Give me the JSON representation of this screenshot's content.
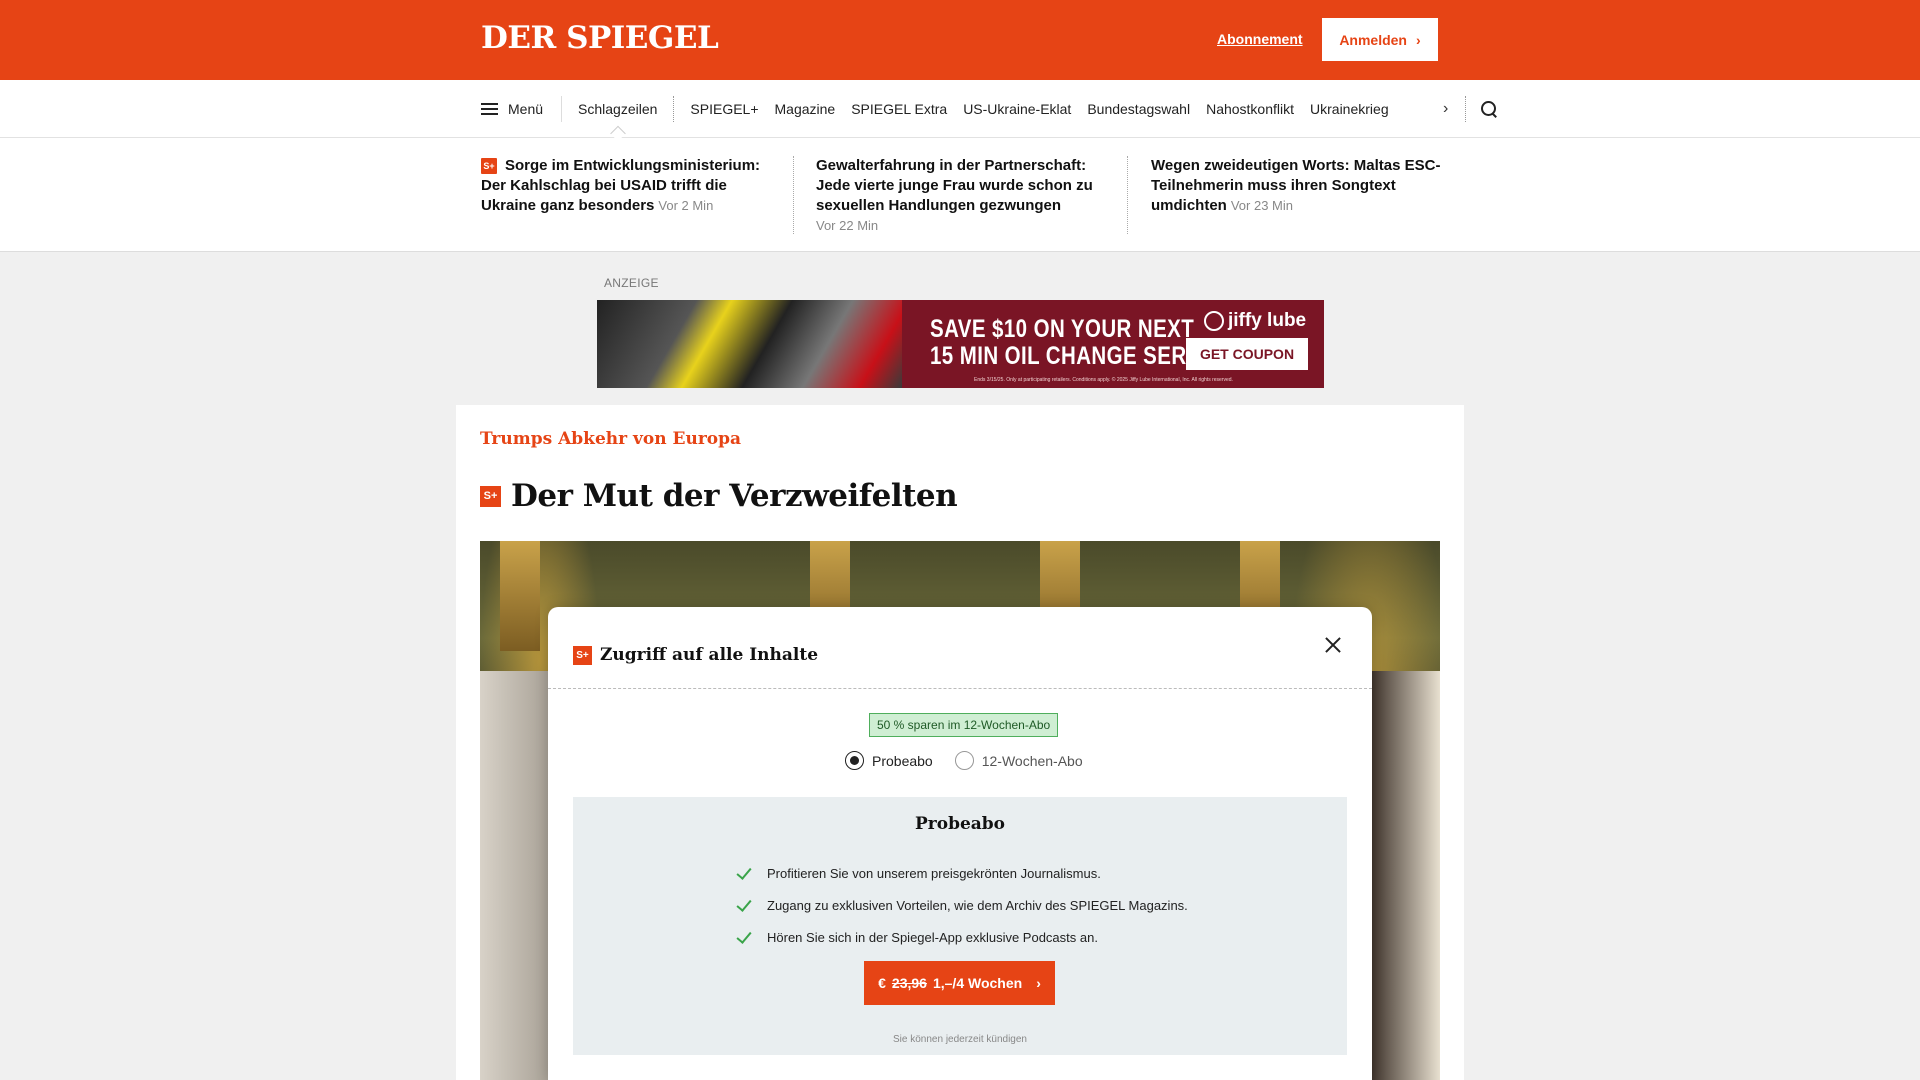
{
  "header": {
    "logo": "DER SPIEGEL",
    "abo_label": "Abonnement",
    "login_label": "Anmelden",
    "login_chevron": "›",
    "brand_color": "#e64415"
  },
  "nav": {
    "menu_label": "Menü",
    "active_label": "Schlagzeilen",
    "items": [
      "SPIEGEL+",
      "Magazine",
      "SPIEGEL Extra",
      "US-Ukraine-Eklat",
      "Bundestagswahl",
      "Nahostkonflikt",
      "Ukrainekrieg"
    ],
    "next_chevron": "›"
  },
  "teasers": [
    {
      "badge": "S+",
      "title": "Sorge im Entwicklungsministerium: Der Kahlschlag bei USAID trifft die Ukraine ganz besonders",
      "time": "Vor 2 Min"
    },
    {
      "title": "Gewalterfahrung in der Partnerschaft: Jede vierte junge Frau wurde schon zu sexuellen Handlungen gezwungen",
      "time": "Vor 22 Min"
    },
    {
      "title": "Wegen zweideutigen Worts: Maltas ESC-Teilnehmerin muss ihren Songtext umdichten",
      "time": "Vor 23 Min"
    }
  ],
  "ad": {
    "label": "ANZEIGE",
    "line1": "SAVE $10 ON YOUR NEXT",
    "line2": "15 MIN OIL CHANGE SERVICE",
    "brand": "jiffy lube",
    "coupon": "GET COUPON",
    "fine": "Ends 3/15/25. Only at participating retailers. Conditions apply. © 2025 Jiffy Lube International, Inc. All rights reserved."
  },
  "article": {
    "kicker": "Trumps Abkehr von Europa",
    "badge": "S+",
    "headline": "Der Mut der Verzweifelten"
  },
  "modal": {
    "badge": "S+",
    "title": "Zugriff auf alle Inhalte",
    "savings_badge": "50 % sparen im 12-Wochen-Abo",
    "options": [
      {
        "label": "Probeabo",
        "selected": true
      },
      {
        "label": "12-Wochen-Abo",
        "selected": false
      }
    ],
    "offer_title": "Probeabo",
    "benefits": [
      "Profitieren Sie von unserem preisgekrönten Journalismus.",
      "Zugang zu exklusiven Vorteilen, wie dem Archiv des SPIEGEL Magazins.",
      "Hören Sie sich in der Spiegel-App exklusive Podcasts an."
    ],
    "cta_currency": "€",
    "cta_old_price": "23,96",
    "cta_price": "1,–/4 Wochen",
    "cta_chevron": "›",
    "cancel_note": "Sie können jederzeit kündigen"
  }
}
